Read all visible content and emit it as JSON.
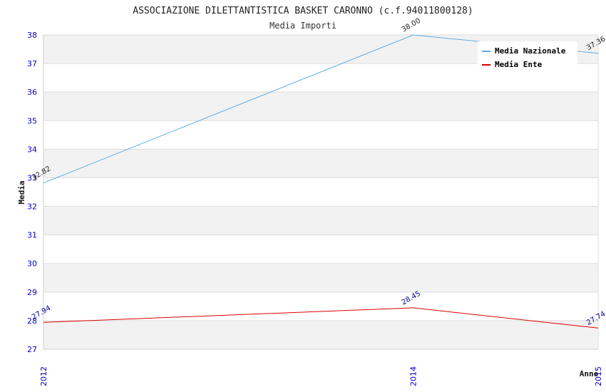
{
  "chart_data": {
    "type": "line",
    "title": "ASSOCIAZIONE DILETTANTISTICA BASKET CARONNO (c.f.94011800128)",
    "subtitle": "Media Importi",
    "xlabel": "Anno",
    "ylabel": "Media",
    "x": [
      "2012",
      "2014",
      "2015"
    ],
    "ylim": [
      27,
      38
    ],
    "yticks": [
      "27",
      "28",
      "29",
      "30",
      "31",
      "32",
      "33",
      "34",
      "35",
      "36",
      "37",
      "38"
    ],
    "grid": true,
    "legend_position": "top-right",
    "series": [
      {
        "name": "Media Nazionale",
        "color": "#5dade2",
        "label_color": "#222222",
        "values": [
          32.82,
          38.0,
          37.36
        ],
        "labels": [
          "32.82",
          "38.00",
          "37.36"
        ]
      },
      {
        "name": "Media Ente",
        "color": "#dd0000",
        "label_color": "#000099",
        "values": [
          27.94,
          28.45,
          27.74
        ],
        "labels": [
          "27.94",
          "28.45",
          "27.74"
        ]
      }
    ]
  }
}
